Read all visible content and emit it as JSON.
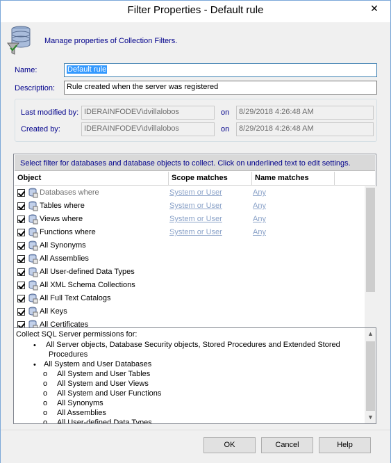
{
  "window": {
    "title": "Filter Properties - Default rule",
    "close_glyph": "✕"
  },
  "header": {
    "text": "Manage properties of Collection Filters.",
    "icon": "database-filter-icon"
  },
  "name": {
    "label": "Name:",
    "value": "Default rule"
  },
  "description": {
    "label": "Description:",
    "value": "Rule created when the server was registered"
  },
  "modified": {
    "label": "Last modified by:",
    "user": "IDERAINFODEV\\dvillalobos",
    "on_label": "on",
    "date": "8/29/2018 4:26:48 AM"
  },
  "created": {
    "label": "Created by:",
    "user": "IDERAINFODEV\\dvillalobos",
    "on_label": "on",
    "date": "8/29/2018 4:26:48 AM"
  },
  "filter": {
    "instructions": "Select filter for databases and database objects to collect. Click on underlined text to edit settings.",
    "columns": {
      "object": "Object",
      "scope": "Scope matches",
      "name": "Name matches"
    },
    "rows": [
      {
        "label": "Databases where",
        "scope": "System or User",
        "name": "Any",
        "checked": true,
        "grey": true
      },
      {
        "label": "Tables where",
        "scope": "System or User",
        "name": "Any",
        "checked": true
      },
      {
        "label": "Views where",
        "scope": "System or User",
        "name": "Any",
        "checked": true
      },
      {
        "label": "Functions where",
        "scope": "System or User",
        "name": "Any",
        "checked": true
      },
      {
        "label": "All Synonyms",
        "checked": true
      },
      {
        "label": "All Assemblies",
        "checked": true
      },
      {
        "label": "All User-defined Data Types",
        "checked": true
      },
      {
        "label": "All XML Schema Collections",
        "checked": true
      },
      {
        "label": "All Full Text Catalogs",
        "checked": true
      },
      {
        "label": "All Keys",
        "checked": true
      },
      {
        "label": "All Certificates",
        "checked": true
      }
    ]
  },
  "permissions": {
    "intro": "Collect SQL Server permissions for:",
    "bullet1": "All Server objects, Database Security objects, Stored Procedures and Extended Stored",
    "bullet1_cont": "Procedures",
    "bullet2": "All System and User Databases",
    "subitems": [
      "All System and User Tables",
      "All System and User Views",
      "All System and User Functions",
      "All Synonyms",
      "All Assemblies",
      "All User-defined Data Types"
    ],
    "bullet_glyph": "•",
    "sub_glyph": "o"
  },
  "buttons": {
    "ok": "OK",
    "cancel": "Cancel",
    "help": "Help"
  }
}
